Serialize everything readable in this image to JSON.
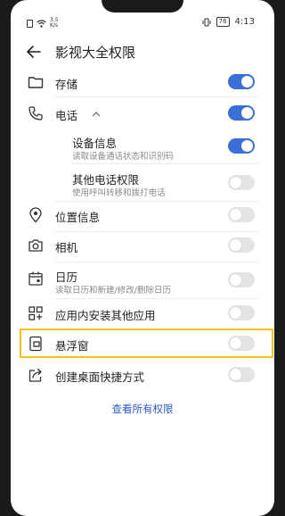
{
  "status_bar": {
    "net_speed_value": "3.5",
    "net_speed_unit": "K/s",
    "battery": "76",
    "time": "4:13"
  },
  "header": {
    "title": "影视大全权限"
  },
  "permissions": {
    "storage": {
      "label": "存储",
      "enabled": true
    },
    "phone": {
      "label": "电话",
      "enabled": true,
      "expanded": true
    },
    "device_info": {
      "label": "设备信息",
      "desc": "读取设备通话状态和识别码",
      "enabled": true
    },
    "other_phone": {
      "label": "其他电话权限",
      "desc": "使用呼叫转移和拨打电话",
      "enabled": false
    },
    "location": {
      "label": "位置信息",
      "enabled": false
    },
    "camera": {
      "label": "相机",
      "enabled": false
    },
    "calendar": {
      "label": "日历",
      "desc": "读取日历和新建/修改/删除日历",
      "enabled": false
    },
    "install_apps": {
      "label": "应用内安装其他应用",
      "enabled": false
    },
    "floating_window": {
      "label": "悬浮窗",
      "enabled": false,
      "highlighted": true,
      "highlight_color": "#f5c21b"
    },
    "shortcut": {
      "label": "创建桌面快捷方式",
      "enabled": false
    }
  },
  "footer": {
    "view_all_label": "查看所有权限"
  },
  "colors": {
    "toggle_on": "#3b6fd8",
    "toggle_off": "#e4e4e4",
    "link": "#2c5bc9"
  }
}
